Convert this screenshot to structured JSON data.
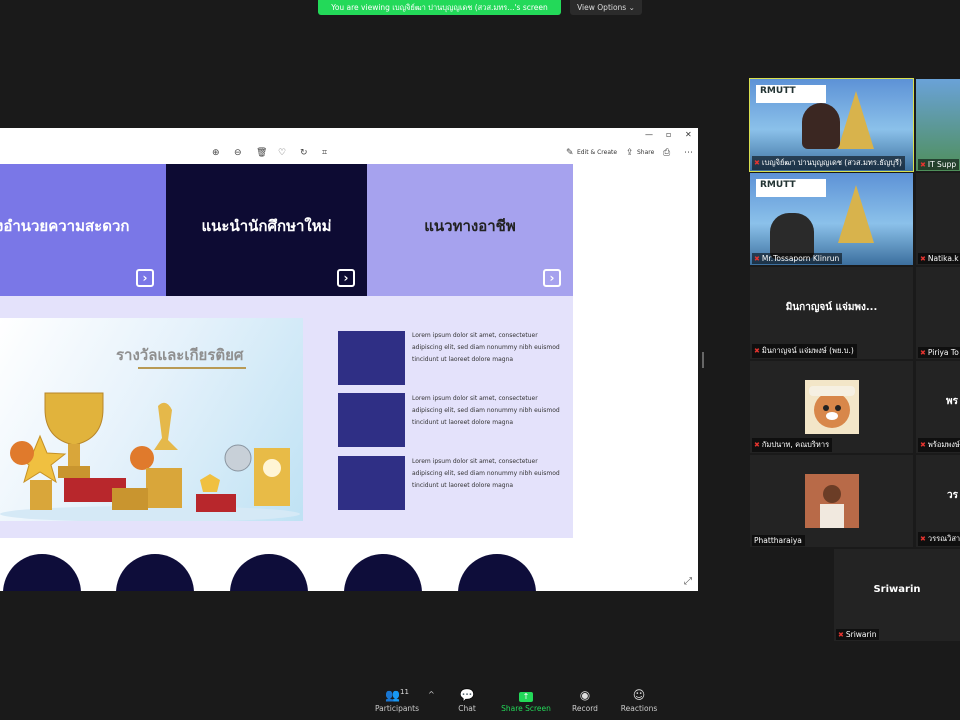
{
  "banner": {
    "viewing_text": "You are viewing เบญจิย์ฒา ปานบุญญเดช (สวส.มทร...'s screen",
    "view_options": "View Options ⌄"
  },
  "window": {
    "min": "—",
    "max": "▫",
    "close": "✕",
    "toolbar": {
      "edit_create": "Edit & Create",
      "share": "Share"
    }
  },
  "slide": {
    "nav": [
      {
        "label": "งอำนวยความสะดวก",
        "color": "#7a77e7"
      },
      {
        "label": "แนะนำนักศึกษาใหม่",
        "color": "#0d0b33"
      },
      {
        "label": "แนวทางอาชีพ",
        "color": "#a6a2ee"
      }
    ],
    "awards_title": "รางวัลและเกียรติยศ",
    "items": [
      {
        "text": "Lorem ipsum dolor sit amet, consectetuer adipiscing elit, sed diam nonummy nibh euismod tincidunt ut laoreet dolore magna"
      },
      {
        "text": "Lorem ipsum dolor sit amet, consectetuer adipiscing elit, sed diam nonummy nibh euismod tincidunt ut laoreet dolore magna"
      },
      {
        "text": "Lorem ipsum dolor sit amet, consectetuer adipiscing elit, sed diam nonummy nibh euismod tincidunt ut laoreet dolore magna"
      }
    ]
  },
  "participants": [
    {
      "name": "เบญจิย์ฒา ปานบุญญเดช (สวส.มทร.ธัญบุรี)",
      "muted": true,
      "active": true
    },
    {
      "name": "IT Supp",
      "muted": true
    },
    {
      "name": "Mr.Tossaporn Klinrun",
      "muted": true
    },
    {
      "name": "Natika.k",
      "muted": true
    },
    {
      "name": "มินกาญจน์ แจ่มพง...",
      "label": "มินกาญจน์ แจ่มพงษ์ (พย.บ.)",
      "muted": true
    },
    {
      "name": "Piriya To",
      "muted": true
    },
    {
      "name": "กัมปนาท, คณบริหาร",
      "muted": true
    },
    {
      "name": "พร้อมพงษ์",
      "short": "พร",
      "muted": true
    },
    {
      "name": "Phattharaiya",
      "muted": false
    },
    {
      "name": "วรรณวิสา",
      "short": "วร",
      "muted": true
    },
    {
      "name": "Sriwarin",
      "muted": true
    }
  ],
  "bottom_toolbar": {
    "participants_count": "11",
    "participants": "Participants",
    "chat": "Chat",
    "share_screen": "Share Screen",
    "record": "Record",
    "reactions": "Reactions"
  }
}
